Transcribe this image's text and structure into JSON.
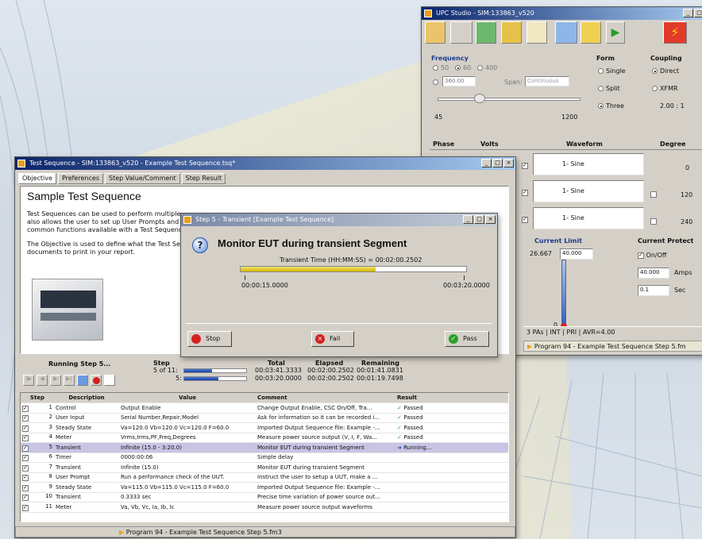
{
  "upc": {
    "title": "UPC Studio - SIM:133863_v520",
    "frequency": {
      "label": "Frequency",
      "opt1": "50",
      "opt2": "60",
      "opt3": "400",
      "custom": "360.00",
      "span_label": "Span:",
      "span_value": "Continuous",
      "min": "45",
      "max": "1200"
    },
    "form": {
      "label": "Form",
      "opts": [
        "Single",
        "Split",
        "Three"
      ]
    },
    "coupling": {
      "label": "Coupling",
      "opts": [
        "Direct",
        "XFMR"
      ],
      "ratio": "2.00 : 1"
    },
    "grid": {
      "phase": "Phase",
      "volts": "Volts",
      "waveform": "Waveform",
      "degree": "Degree",
      "rows": [
        {
          "wave": "1- Sine",
          "deg": "0"
        },
        {
          "wave": "1- Sine",
          "deg": "120"
        },
        {
          "wave": "1- Sine",
          "deg": "240"
        }
      ]
    },
    "current_limit": {
      "label": "Current Limit",
      "value": "26.667",
      "field": "40.000",
      "zero": "0"
    },
    "current_protect": {
      "label": "Current Protect",
      "onoff": "On/Off",
      "amps_val": "40.000",
      "amps": "Amps",
      "sec_val": "0.1",
      "sec": "Sec"
    },
    "status": [
      "3 PAs",
      "INT",
      "PRI",
      "AVR=4.00"
    ],
    "program": "Program 94 - Example Test Sequence Step 5.fm"
  },
  "ts": {
    "title": "Test Sequence - SIM:133863_v520 - Example Test Sequence.tsq*",
    "tabs": [
      "Objective",
      "Preferences",
      "Step Value/Comment",
      "Step Result"
    ],
    "heading": "Sample Test Sequence",
    "para1": "Test Sequences can be used to perform multiple",
    "para1b": "also allows the user to set up User Prompts and r",
    "para1c": "common functions available with a Test Sequenc",
    "para2": "The Objective is used to define what the Test Se",
    "para2b": "documents to print in your report.",
    "running": "Running Step 5...",
    "step_hdr": "Step",
    "step_a": "5 of 11:",
    "step_b": "5:",
    "total_hdr": "Total",
    "total_a": "00:03:41.3333",
    "total_b": "00:03:20.0000",
    "elapsed_hdr": "Elapsed",
    "elapsed_a": "00:02:00.2502",
    "elapsed_b": "00:02:00.2502",
    "remaining_hdr": "Remaining",
    "remaining_a": "00:01:41.0831",
    "remaining_b": "00:01:19.7498",
    "cols": [
      "Step",
      "Description",
      "Value",
      "Comment",
      "Result"
    ],
    "rows": [
      {
        "n": "1",
        "d": "Control",
        "v": "Output Enable",
        "c": "Change Output Enable, CSC On/Off, Tra...",
        "r": "Passed"
      },
      {
        "n": "2",
        "d": "User Input",
        "v": "Serial Number,Repair,Model",
        "c": "Ask for information so it can be recorded i...",
        "r": "Passed"
      },
      {
        "n": "3",
        "d": "Steady State",
        "v": "Va=120.0 Vb=120.0 Vc=120.0 F=60.0",
        "c": "Imported Output Sequence file: Example -...",
        "r": "Passed"
      },
      {
        "n": "4",
        "d": "Meter",
        "v": "Vrms,Irms,PF,Freq,Degrees",
        "c": "Measure power source output (V, I, F, Wa...",
        "r": "Passed"
      },
      {
        "n": "5",
        "d": "Transient",
        "v": "Infinite (15.0 - 3:20.0)",
        "c": "Monitor EUT during transient Segment",
        "r": "Running..."
      },
      {
        "n": "6",
        "d": "Timer",
        "v": "0000:00:06",
        "c": "Simple delay",
        "r": ""
      },
      {
        "n": "7",
        "d": "Transient",
        "v": "Infinite (15.0)",
        "c": "Monitor EUT during transient Segment",
        "r": ""
      },
      {
        "n": "8",
        "d": "User Prompt",
        "v": "Run a performance check of the UUT.",
        "c": "Instruct the user to setup a UUT, make a ...",
        "r": ""
      },
      {
        "n": "9",
        "d": "Steady State",
        "v": "Va=115.0 Vb=115.0 Vc=115.0 F=60.0",
        "c": "Imported Output Sequence file: Example -...",
        "r": ""
      },
      {
        "n": "10",
        "d": "Transient",
        "v": "0.3333 sec",
        "c": "Precise time variation of power source out...",
        "r": ""
      },
      {
        "n": "11",
        "d": "Meter",
        "v": "Va, Vb, Vc, Ia, Ib, Ic",
        "c": "Measure power source output waveforms",
        "r": ""
      }
    ],
    "program": "Program 94 - Example Test Sequence Step 5.fm3"
  },
  "dlg": {
    "title": "Step 5 - Transient [Example Test Sequence]",
    "message": "Monitor EUT during transient Segment",
    "time_label": "Transient Time (HH:MM:SS) = 00:02:00.2502",
    "t_start": "00:00:15.0000",
    "t_end": "00:03:20.0000",
    "progress": 0.6,
    "stop": "Stop",
    "fail": "Fail",
    "pass": "Pass"
  },
  "progress": {
    "step": 0.45,
    "total": 0.55
  }
}
